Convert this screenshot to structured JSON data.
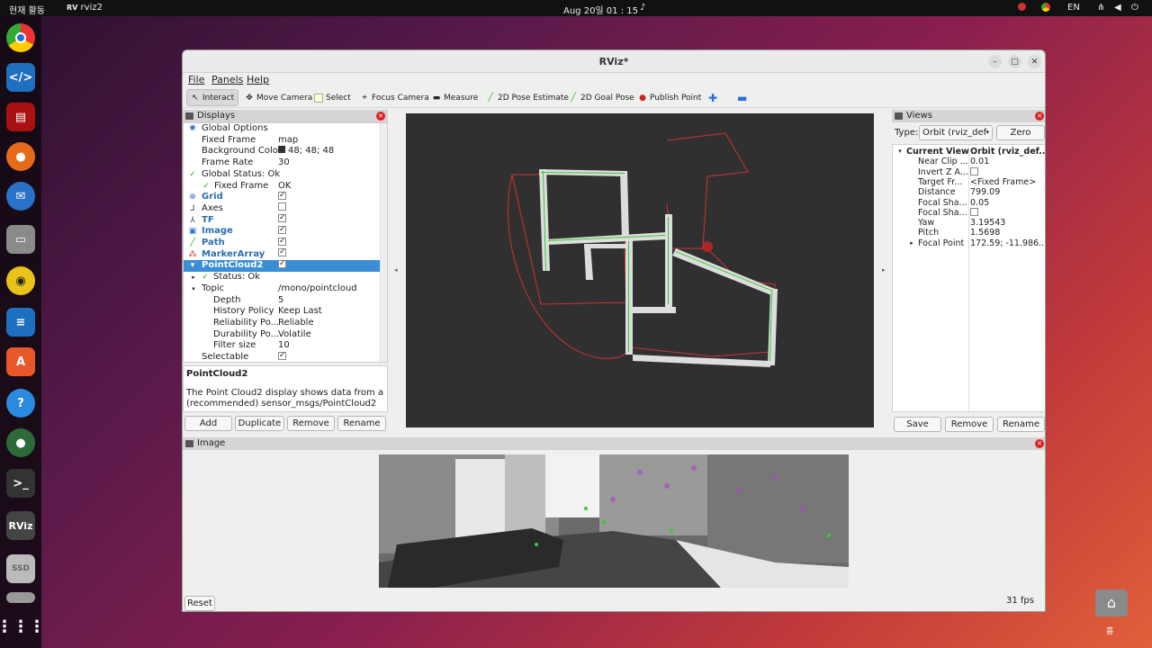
{
  "topbar": {
    "activities": "현재 활동",
    "app_name": "rviz2",
    "datetime": "Aug 20일  01 : 15",
    "lang": "EN"
  },
  "dock": {
    "items": [
      "chrome",
      "vscode",
      "terminal-red",
      "firefox",
      "thunderbird",
      "files",
      "rhythmbox",
      "writer",
      "app-center",
      "help",
      "earth",
      "terminal",
      "rviz",
      "ssd",
      "drive",
      "show-apps"
    ],
    "rviz_label": "RViz",
    "ssd_label": "SSD"
  },
  "window": {
    "title": "RViz*",
    "menus": [
      "File",
      "Panels",
      "Help"
    ],
    "tools": [
      "Interact",
      "Move Camera",
      "Select",
      "Focus Camera",
      "Measure",
      "2D Pose Estimate",
      "2D Goal Pose",
      "Publish Point"
    ]
  },
  "displays": {
    "title": "Displays",
    "rows": [
      {
        "key": "Global Options",
        "value": ""
      },
      {
        "key": "Fixed Frame",
        "value": "map"
      },
      {
        "key": "Background Color",
        "value": "48; 48; 48"
      },
      {
        "key": "Frame Rate",
        "value": "30"
      },
      {
        "key": "Global Status: Ok",
        "value": ""
      },
      {
        "key": "Fixed Frame",
        "value": "OK"
      },
      {
        "key": "Grid",
        "value": ""
      },
      {
        "key": "Axes",
        "value": ""
      },
      {
        "key": "TF",
        "value": ""
      },
      {
        "key": "Image",
        "value": ""
      },
      {
        "key": "Path",
        "value": ""
      },
      {
        "key": "MarkerArray",
        "value": ""
      },
      {
        "key": "PointCloud2",
        "value": ""
      },
      {
        "key": "Status: Ok",
        "value": ""
      },
      {
        "key": "Topic",
        "value": "/mono/pointcloud"
      },
      {
        "key": "Depth",
        "value": "5"
      },
      {
        "key": "History Policy",
        "value": "Keep Last"
      },
      {
        "key": "Reliability Po...",
        "value": "Reliable"
      },
      {
        "key": "Durability Po...",
        "value": "Volatile"
      },
      {
        "key": "Filter size",
        "value": "10"
      },
      {
        "key": "Selectable",
        "value": ""
      }
    ],
    "desc_title": "PointCloud2",
    "desc_text": "The Point Cloud2 display shows data from a (recommended) sensor_msgs/PointCloud2",
    "buttons": [
      "Add",
      "Duplicate",
      "Remove",
      "Rename"
    ],
    "bg_color": "#303030"
  },
  "views": {
    "title": "Views",
    "type_label": "Type:",
    "type_value": "Orbit (rviz_def",
    "zero": "Zero",
    "rows": [
      {
        "key": "Current View",
        "value": "Orbit (rviz_def..."
      },
      {
        "key": "Near Clip ...",
        "value": "0.01"
      },
      {
        "key": "Invert Z A...",
        "value": ""
      },
      {
        "key": "Target Fr...",
        "value": "<Fixed Frame>"
      },
      {
        "key": "Distance",
        "value": "799.09"
      },
      {
        "key": "Focal Sha...",
        "value": "0.05"
      },
      {
        "key": "Focal Sha...",
        "value": ""
      },
      {
        "key": "Yaw",
        "value": "3.19543"
      },
      {
        "key": "Pitch",
        "value": "1.5698"
      },
      {
        "key": "Focal Point",
        "value": "172.59; -11.986..."
      }
    ],
    "buttons": [
      "Save",
      "Remove",
      "Rename"
    ]
  },
  "image_panel": {
    "title": "Image"
  },
  "footer": {
    "reset": "Reset",
    "fps": "31 fps"
  },
  "desktop": {
    "home_label": "홈"
  }
}
